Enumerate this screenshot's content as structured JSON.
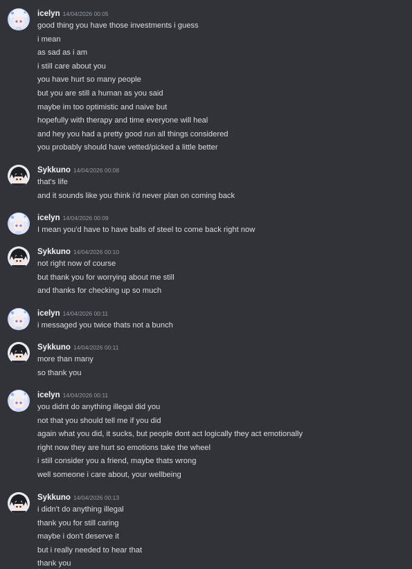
{
  "colors": {
    "background": "#313338",
    "username": "#f2f3f5",
    "timestamp": "#949ba4",
    "message_text": "#dbdee1"
  },
  "messages": [
    {
      "author": "icelyn",
      "avatar_icon": "icelyn-avatar-icon",
      "timestamp": "14/04/2026 00:05",
      "lines": [
        "good thing you have those investments i guess",
        "i mean",
        "as sad as i am",
        "i still care about you",
        "you have hurt so many people",
        "but you are still a human as you said",
        "maybe im too optimistic and naive but",
        "hopefully with therapy and time everyone will heal",
        "and hey you had a pretty good run all things considered",
        "you probably should have vetted/picked a little better"
      ]
    },
    {
      "author": "Sykkuno",
      "avatar_icon": "sykkuno-avatar-icon",
      "timestamp": "14/04/2026 00:08",
      "lines": [
        "that's life",
        "and it sounds like you think i'd never plan on coming back"
      ]
    },
    {
      "author": "icelyn",
      "avatar_icon": "icelyn-avatar-icon",
      "timestamp": "14/04/2026 00:09",
      "lines": [
        "I mean you'd have to have balls of steel to come back right now"
      ]
    },
    {
      "author": "Sykkuno",
      "avatar_icon": "sykkuno-avatar-icon",
      "timestamp": "14/04/2026 00:10",
      "lines": [
        "not right now of course",
        "but thank you for worrying about me still",
        "and thanks for checking up so much"
      ]
    },
    {
      "author": "icelyn",
      "avatar_icon": "icelyn-avatar-icon",
      "timestamp": "14/04/2026 00:11",
      "lines": [
        "i messaged you twice thats not a bunch"
      ]
    },
    {
      "author": "Sykkuno",
      "avatar_icon": "sykkuno-avatar-icon",
      "timestamp": "14/04/2026 00:11",
      "lines": [
        "more than many",
        "so thank you"
      ]
    },
    {
      "author": "icelyn",
      "avatar_icon": "icelyn-avatar-icon",
      "timestamp": "14/04/2026 00:11",
      "lines": [
        "you didnt do anything illegal did you",
        "not that you should tell me if you did",
        "again what you did, it sucks, but people dont act logically they act emotionally",
        "right now they are hurt so emotions take the wheel",
        "i still consider you a friend, maybe thats wrong",
        "well someone i care about, your wellbeing"
      ]
    },
    {
      "author": "Sykkuno",
      "avatar_icon": "sykkuno-avatar-icon",
      "timestamp": "14/04/2026 00:13",
      "lines": [
        "i didn't do anything illegal",
        "thank you for still caring",
        "maybe i don't deserve it",
        "but i really needed to hear that",
        "thank you"
      ]
    }
  ]
}
